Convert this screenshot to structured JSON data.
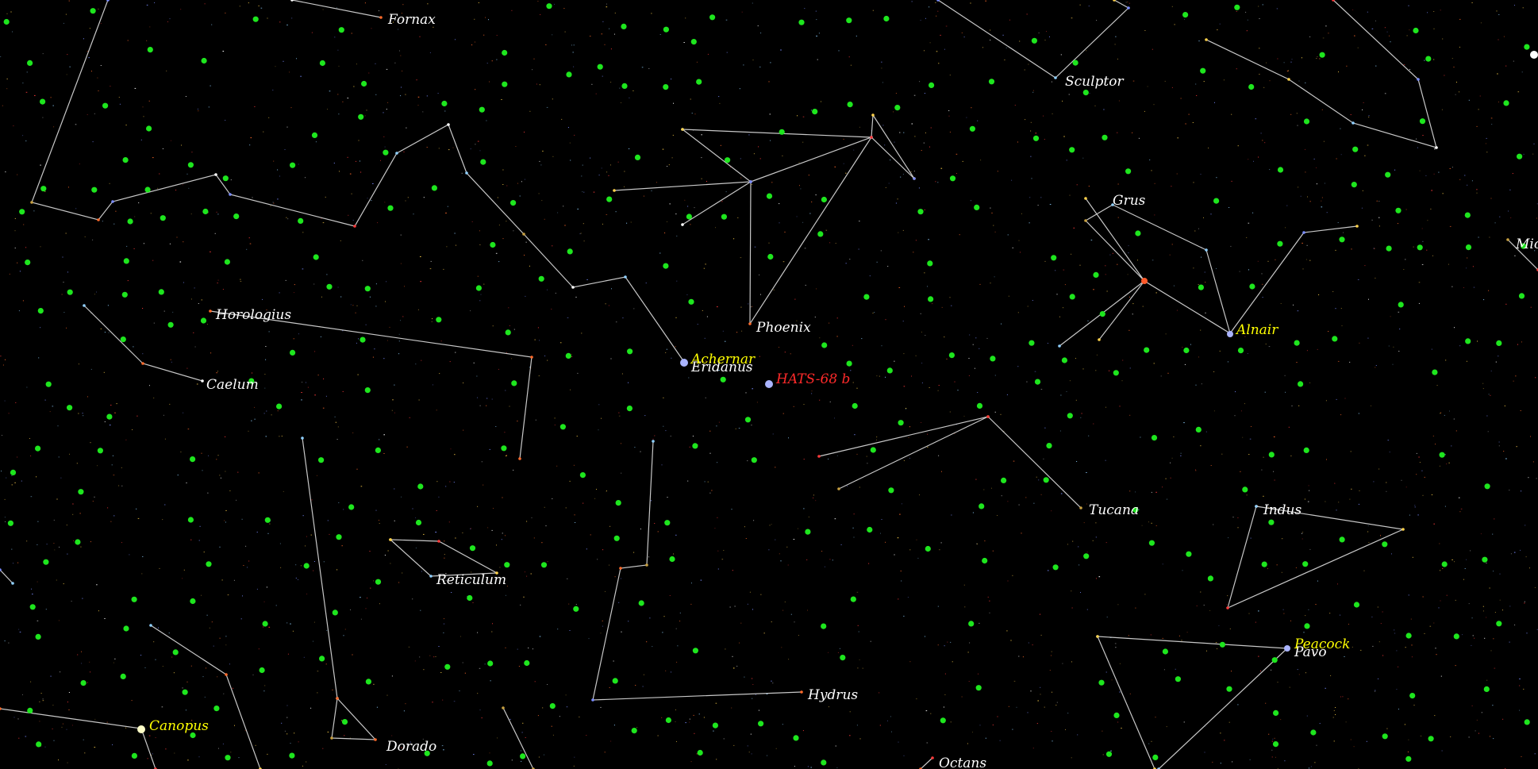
{
  "view": {
    "projection_note": "",
    "colors": {
      "background": "#000000",
      "constellation_line": "#c8c8c8",
      "constellation_label": "#ffffff",
      "named_star_label": "#ffff00",
      "target_label": "#ff2a2a",
      "marker_dot": "#1ee61e",
      "named_star_dot": "#aab4ff"
    }
  },
  "constellations": [
    {
      "id": "fornax",
      "name": "Fornax"
    },
    {
      "id": "sculptor",
      "name": "Sculptor"
    },
    {
      "id": "grus",
      "name": "Grus"
    },
    {
      "id": "horologium",
      "name": "Horologius"
    },
    {
      "id": "caelum",
      "name": "Caelum"
    },
    {
      "id": "phoenix",
      "name": "Phoenix"
    },
    {
      "id": "eridanus",
      "name": "Eridanus"
    },
    {
      "id": "tucana",
      "name": "Tucana"
    },
    {
      "id": "indus",
      "name": "Indus"
    },
    {
      "id": "reticulum",
      "name": "Reticulum"
    },
    {
      "id": "hydrus",
      "name": "Hydrus"
    },
    {
      "id": "pavo",
      "name": "Pavo"
    },
    {
      "id": "dorado",
      "name": "Dorado"
    },
    {
      "id": "octans",
      "name": "Octans"
    },
    {
      "id": "microscopium",
      "name": "Mic"
    }
  ],
  "named_stars": [
    {
      "id": "achernar",
      "name": "Achernar"
    },
    {
      "id": "alnair",
      "name": "Alnair"
    },
    {
      "id": "peacock",
      "name": "Peacock"
    },
    {
      "id": "canopus",
      "name": "Canopus"
    }
  ],
  "target": {
    "id": "hats-68b",
    "name": "HATS-68 b"
  }
}
